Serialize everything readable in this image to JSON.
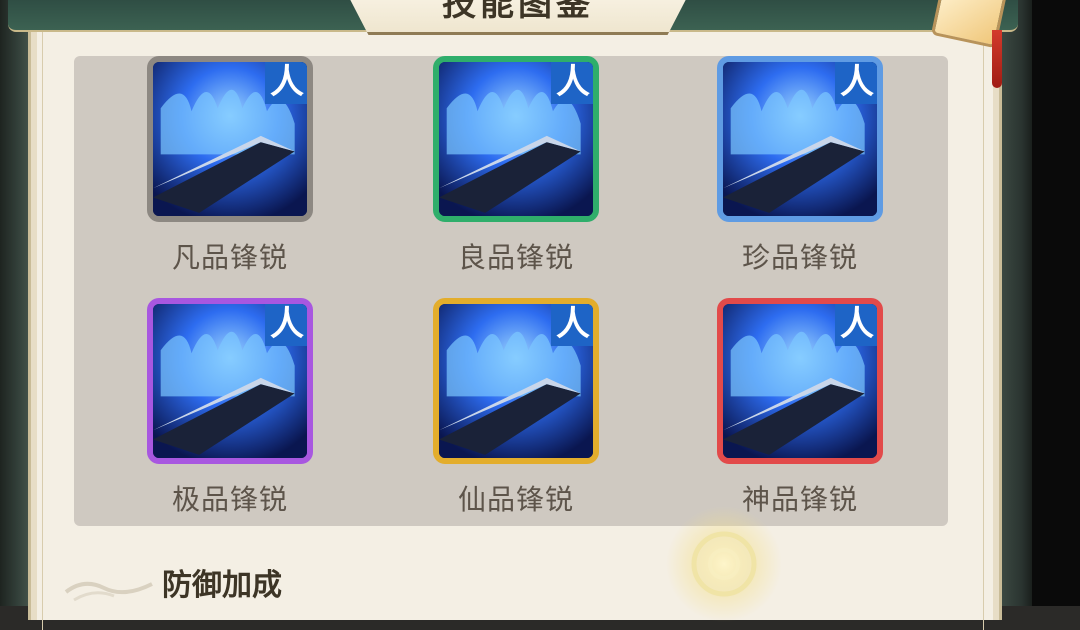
{
  "header": {
    "title": "技能图鉴"
  },
  "skills": [
    {
      "label": "凡品锋锐",
      "tag": "人",
      "quality_color": "#8d8882"
    },
    {
      "label": "良品锋锐",
      "tag": "人",
      "quality_color": "#2fae6b"
    },
    {
      "label": "珍品锋锐",
      "tag": "人",
      "quality_color": "#5f9be3"
    },
    {
      "label": "极品锋锐",
      "tag": "人",
      "quality_color": "#a857e0"
    },
    {
      "label": "仙品锋锐",
      "tag": "人",
      "quality_color": "#e3ad2c"
    },
    {
      "label": "神品锋锐",
      "tag": "人",
      "quality_color": "#e24a4a"
    }
  ],
  "section": {
    "title": "防御加成"
  },
  "icons": {
    "skill_art": "blue-flame-blade-icon",
    "corner": "scroll-badge-icon"
  }
}
